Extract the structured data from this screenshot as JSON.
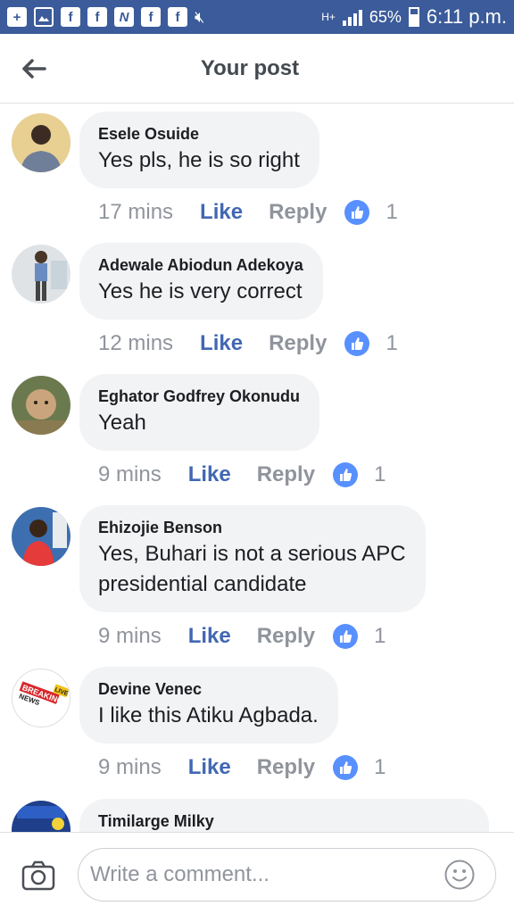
{
  "status_bar": {
    "network": "H+",
    "battery": "65%",
    "time": "6:11 p.m.",
    "battery_level": 0.65,
    "icons": [
      "plus-icon",
      "image-icon",
      "facebook-icon",
      "facebook-icon",
      "n-app-icon",
      "facebook-icon",
      "facebook-icon",
      "mute-icon"
    ]
  },
  "header": {
    "title": "Your post"
  },
  "comments": [
    {
      "author": "Esele Osuide",
      "text": "Yes pls, he is so right",
      "time": "17 mins",
      "like": "Like",
      "reply": "Reply",
      "likes": "1"
    },
    {
      "author": "Adewale Abiodun Adekoya",
      "text": "Yes he is very correct",
      "time": "12 mins",
      "like": "Like",
      "reply": "Reply",
      "likes": "1"
    },
    {
      "author": "Eghator Godfrey Okonudu",
      "text": "Yeah",
      "time": "9 mins",
      "like": "Like",
      "reply": "Reply",
      "likes": "1"
    },
    {
      "author": "Ehizojie Benson",
      "text_lines": [
        "Yes, Buhari is not a serious APC",
        "presidential candidate"
      ],
      "time": "9 mins",
      "like": "Like",
      "reply": "Reply",
      "likes": "1"
    },
    {
      "author": "Devine Venec",
      "text": "I like this Atiku Agbada.",
      "time": "9 mins",
      "like": "Like",
      "reply": "Reply",
      "likes": "1"
    },
    {
      "author": "Timilarge Milky"
    }
  ],
  "avatar_badges": {
    "breaking": "BREAKING",
    "news": "NEWS",
    "live": "LIVE"
  },
  "composer": {
    "placeholder": "Write a comment..."
  },
  "colors": {
    "status_bar": "#3b5b9a",
    "link_blue": "#4267b2",
    "bubble_bg": "#f2f3f5",
    "reaction_blue": "#5890ff",
    "meta_gray": "#90949c"
  }
}
